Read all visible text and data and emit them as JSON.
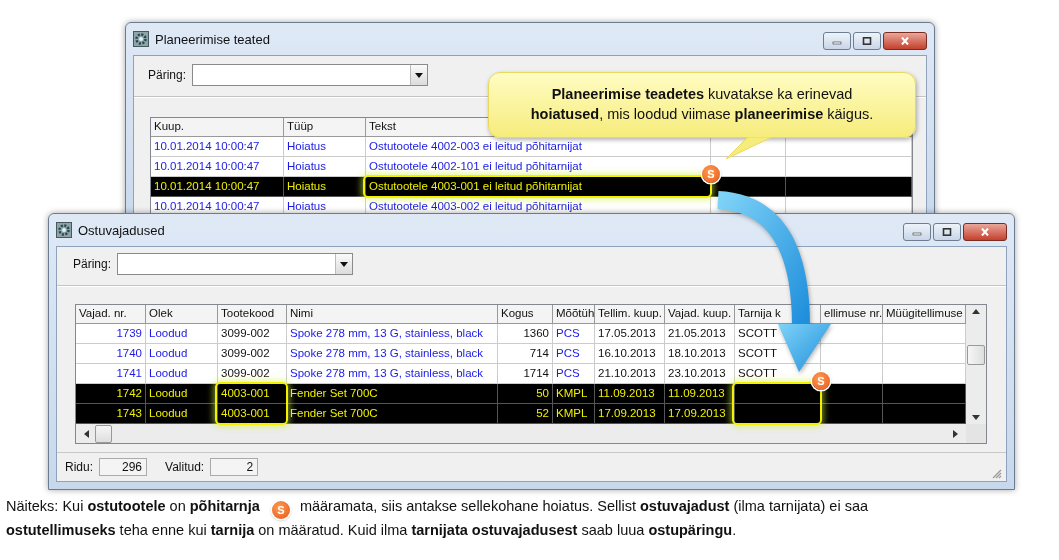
{
  "window1": {
    "title": "Planeerimise teated",
    "query_label": "Päring:",
    "table": {
      "columns": [
        {
          "label": "Kuup.",
          "kind": "link",
          "highlighted": false
        },
        {
          "label": "Tüüp",
          "kind": "link",
          "highlighted": false
        },
        {
          "label": "Tekst",
          "kind": "link",
          "highlighted": true,
          "marker": "S"
        },
        {
          "kind": "blank"
        },
        {
          "kind": "blank"
        }
      ],
      "rows": [
        {
          "selected": false,
          "cells": [
            "10.01.2014 10:00:47",
            "Hoiatus",
            "Ostutootele 4002-003 ei leitud põhitarnijat"
          ]
        },
        {
          "selected": false,
          "cells": [
            "10.01.2014 10:00:47",
            "Hoiatus",
            "Ostutootele 4002-101 ei leitud põhitarnijat"
          ]
        },
        {
          "selected": true,
          "cells": [
            "10.01.2014 10:00:47",
            "Hoiatus",
            "Ostutootele 4003-001 ei leitud põhitarnijat"
          ]
        },
        {
          "selected": false,
          "cells": [
            "10.01.2014 10:00:47",
            "Hoiatus",
            "Ostutootele 4003-002 ei leitud põhitarnijat"
          ]
        }
      ]
    }
  },
  "callout": {
    "text": "**Planeerimise teadetes** kuvatakse ka erinevad **hoiatused**, mis loodud viimase **planeerimise** käigus."
  },
  "window2": {
    "title": "Ostuvajadused",
    "query_label": "Päring:",
    "table": {
      "columns": [
        {
          "label": "Vajad. nr.",
          "kind": "link-number",
          "highlighted": false
        },
        {
          "label": "Olek",
          "kind": "link",
          "highlighted": false
        },
        {
          "label": "Tootekood",
          "kind": "plain",
          "highlighted": true
        },
        {
          "label": "Nimi",
          "kind": "link",
          "highlighted": false
        },
        {
          "label": "Kogus",
          "kind": "number",
          "highlighted": false
        },
        {
          "label": "Mõõtüh",
          "kind": "link",
          "highlighted": false
        },
        {
          "label": "Tellim. kuup.",
          "kind": "plain",
          "highlighted": false
        },
        {
          "label": "Vajad. kuup.",
          "kind": "plain",
          "highlighted": false
        },
        {
          "label": "Tarnija k",
          "kind": "plain",
          "highlighted": true,
          "marker": "S"
        },
        {
          "label": "ellimuse nr.",
          "kind": "plain",
          "highlighted": false
        },
        {
          "label": "Müügitellimuse",
          "kind": "plain",
          "highlighted": false
        }
      ],
      "rows": [
        {
          "selected": false,
          "cells": [
            "1739",
            "Loodud",
            "3099-002",
            "Spoke 278 mm, 13 G, stainless, black",
            "1360",
            "PCS",
            "17.05.2013",
            "21.05.2013",
            "SCOTT"
          ]
        },
        {
          "selected": false,
          "cells": [
            "1740",
            "Loodud",
            "3099-002",
            "Spoke 278 mm, 13 G, stainless, black",
            "714",
            "PCS",
            "16.10.2013",
            "18.10.2013",
            "SCOTT"
          ]
        },
        {
          "selected": false,
          "cells": [
            "1741",
            "Loodud",
            "3099-002",
            "Spoke 278 mm, 13 G, stainless, black",
            "1714",
            "PCS",
            "21.10.2013",
            "23.10.2013",
            "SCOTT"
          ]
        },
        {
          "selected": true,
          "cells": [
            "1742",
            "Loodud",
            "4003-001",
            "Fender Set 700C",
            "50",
            "KMPL",
            "11.09.2013",
            "11.09.2013"
          ]
        },
        {
          "selected": true,
          "cells": [
            "1743",
            "Loodud",
            "4003-001",
            "Fender Set 700C",
            "52",
            "KMPL",
            "17.09.2013",
            "17.09.2013"
          ]
        }
      ]
    },
    "status": [
      {
        "label": "Ridu:",
        "value": "296"
      },
      {
        "label": "Valitud:",
        "value": "2"
      }
    ]
  },
  "caption": {
    "before": "Näiteks: Kui **ostutootele** on **põhitarnja**",
    "marker": "S",
    "after": "määramata, siis antakse sellekohane hoiatus. Sellist **ostuvajadust** (ilma tarnijata) ei saa",
    "continuation": "**ostutellimuseks** teha enne kui **tarnija** on määratud. Kuid ilma **tarnijata ostuvajadusest** saab luua **ostupäringu**."
  }
}
